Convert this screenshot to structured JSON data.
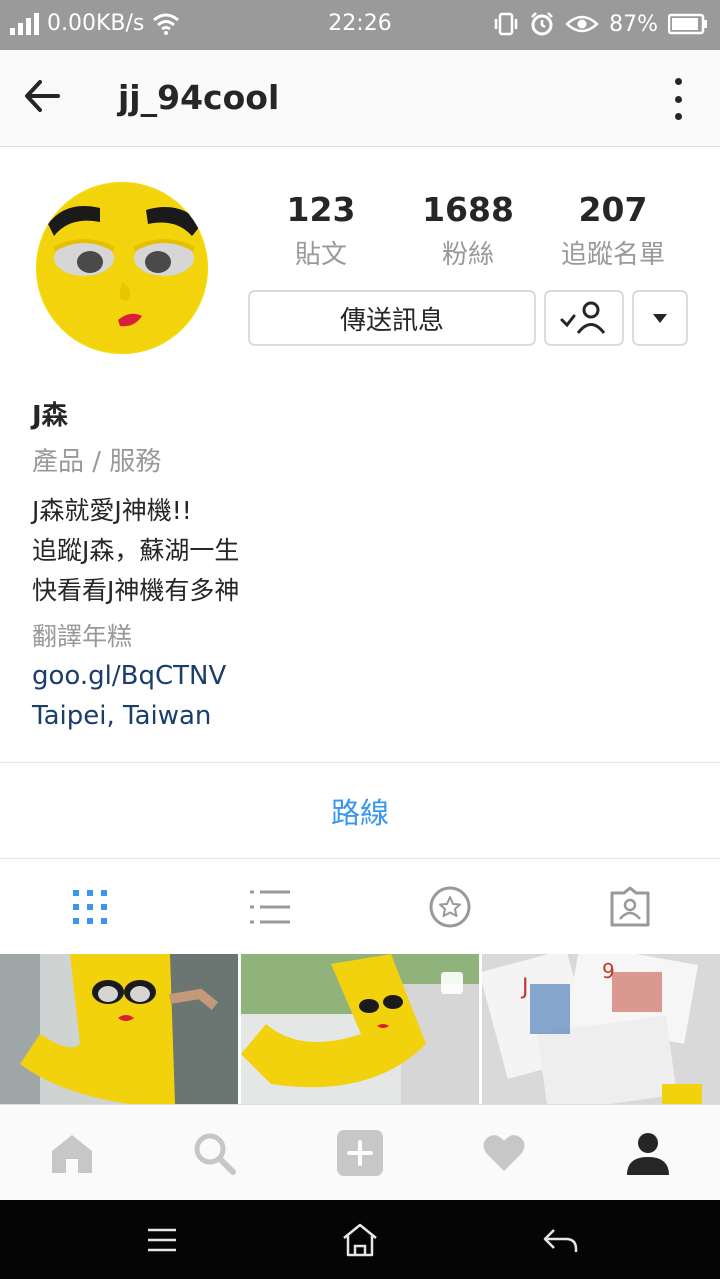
{
  "status_bar": {
    "network_speed": "0.00KB/s",
    "time": "22:26",
    "battery": "87%"
  },
  "header": {
    "username": "jj_94cool",
    "back_icon": "arrow-left-icon",
    "more_icon": "more-vertical-icon"
  },
  "profile": {
    "stats": [
      {
        "value": "123",
        "label": "貼文"
      },
      {
        "value": "1688",
        "label": "粉絲"
      },
      {
        "value": "207",
        "label": "追蹤名單"
      }
    ],
    "message_button": "傳送訊息",
    "name": "J森",
    "category": "產品 / 服務",
    "bio_lines": [
      "J森就愛J神機!!",
      "追蹤J森，蘇湖一生",
      "快看看J神機有多神"
    ],
    "translate": "翻譯年糕",
    "website": "goo.gl/BqCTNV",
    "location": "Taipei, Taiwan"
  },
  "directions": {
    "label": "路線"
  },
  "tabs": [
    {
      "icon": "grid-icon",
      "active": true
    },
    {
      "icon": "list-icon",
      "active": false
    },
    {
      "icon": "star-icon",
      "active": false
    },
    {
      "icon": "tagged-icon",
      "active": false
    }
  ],
  "bottom_nav": [
    {
      "icon": "home-icon"
    },
    {
      "icon": "search-icon"
    },
    {
      "icon": "add-icon"
    },
    {
      "icon": "heart-icon"
    },
    {
      "icon": "profile-icon"
    }
  ],
  "colors": {
    "accent": "#3897f0",
    "link": "#1b3d6b",
    "mascot_yellow": "#f4d90a"
  }
}
